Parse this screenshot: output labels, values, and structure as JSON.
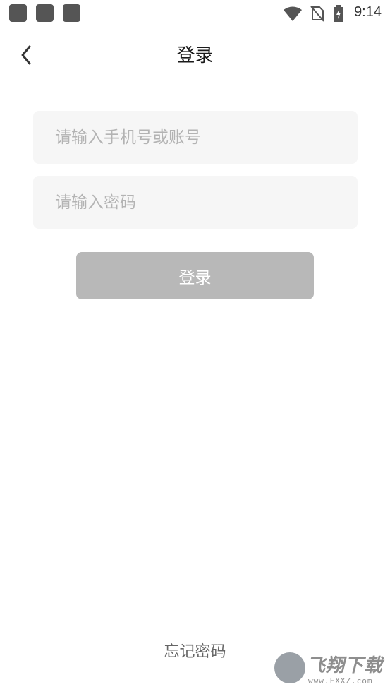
{
  "status_bar": {
    "time": "9:14",
    "icons": [
      "wifi-icon",
      "no-sim-icon",
      "battery-charging-icon"
    ]
  },
  "nav": {
    "back_icon": "chevron-left-icon",
    "title": "登录"
  },
  "form": {
    "account_placeholder": "请输入手机号或账号",
    "password_placeholder": "请输入密码",
    "login_label": "登录"
  },
  "footer": {
    "forgot_password": "忘记密码"
  },
  "watermark": {
    "brand": "飞翔下载",
    "url": "www.FXXZ.com"
  },
  "colors": {
    "button_disabled": "#b8b8b8",
    "field_bg": "#f6f6f6",
    "placeholder": "#b3b3b3"
  }
}
